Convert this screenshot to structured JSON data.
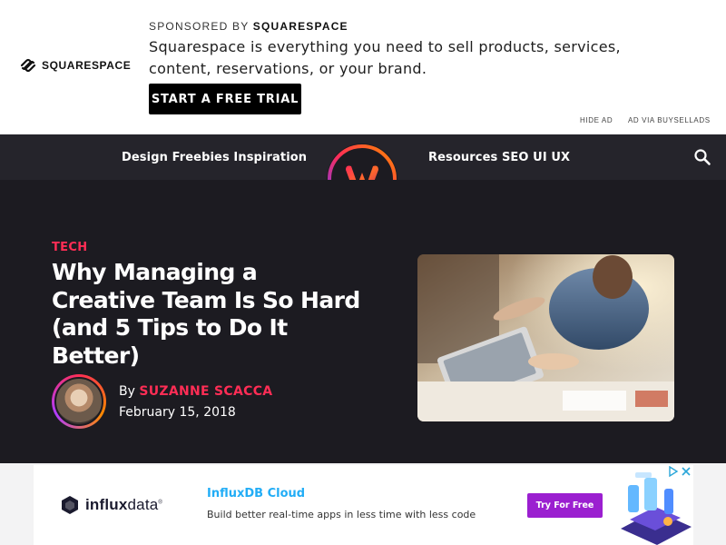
{
  "top_ad": {
    "brand": "SQUARESPACE",
    "sponsored_prefix": "SPONSORED BY",
    "sponsored_brand": "SQUARESPACE",
    "copy": "Squarespace is everything you need to sell products, services, content, reservations, or your brand.",
    "cta": "START A FREE TRIAL",
    "hide_ad": "HIDE AD",
    "ad_via": "AD VIA BUYSELLADS"
  },
  "nav": {
    "left_links": "Design Freebies Inspiration",
    "right_links": "Resources SEO UI UX",
    "search_icon": "search-icon",
    "logo_icon": "w-logo"
  },
  "article": {
    "category": "TECH",
    "title": "Why Managing a Creative Team Is So Hard (and 5 Tips to Do It Better)",
    "by": "By",
    "author": "SUZANNE SCACCA",
    "date": "February 15, 2018"
  },
  "bottom_ad": {
    "brand_light": "influx",
    "brand_bold": "data",
    "brand_mark": "®",
    "title": "InfluxDB Cloud",
    "description": "Build better real-time apps in less time with less code",
    "cta": "Try For Free"
  },
  "colors": {
    "accent": "#ff2d55",
    "page_bg": "#1c1b21",
    "nav_bg": "#25242b",
    "ad_title": "#22adf6",
    "ad_cta": "#9b1fd0"
  }
}
